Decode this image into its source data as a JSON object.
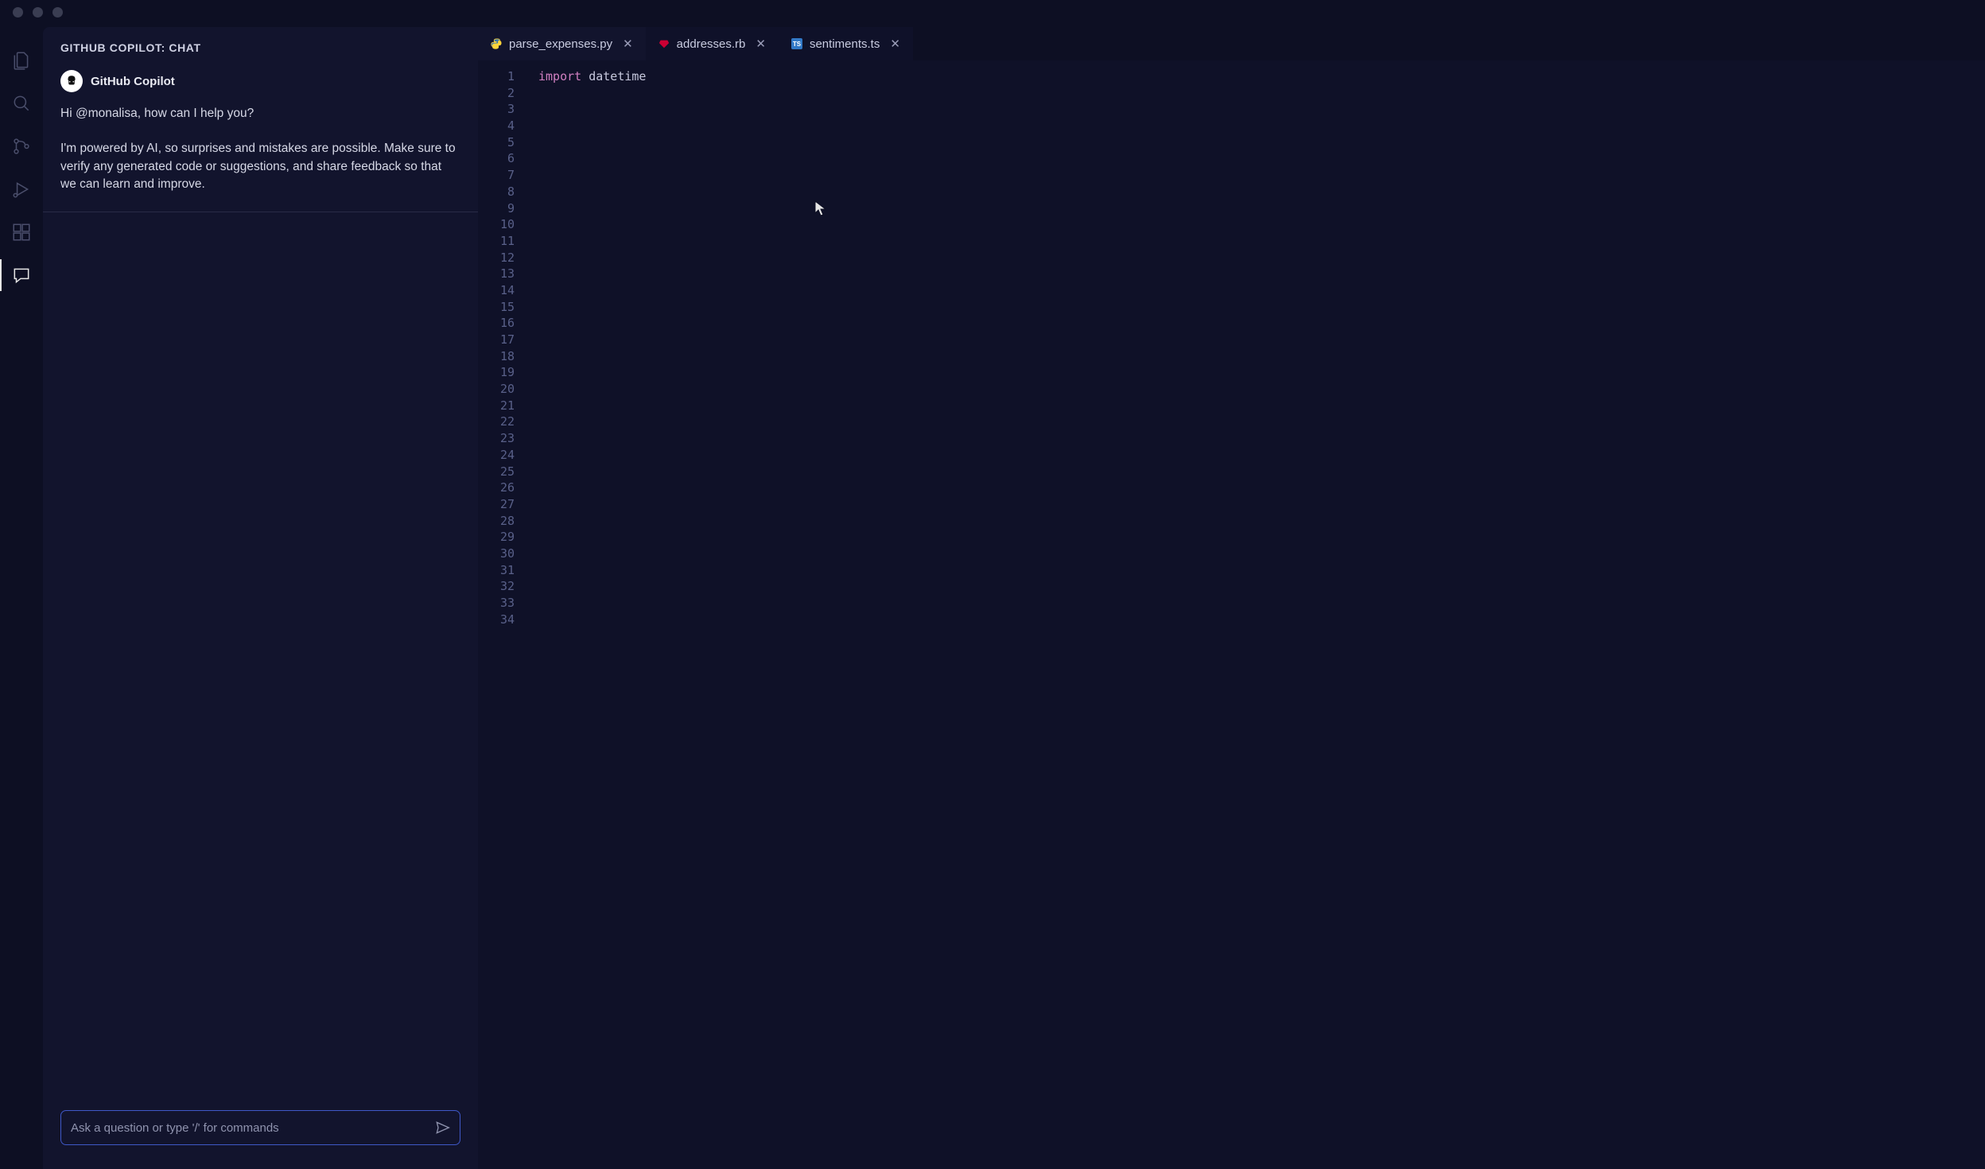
{
  "chat": {
    "header": "GITHUB COPILOT: CHAT",
    "sender_name": "GitHub Copilot",
    "greeting_prefix": "Hi ",
    "greeting_mention": "@monalisa",
    "greeting_suffix": ", how can I help you?",
    "disclaimer": "I'm powered by AI, so surprises and mistakes are possible. Make sure to verify any generated code or suggestions, and share feedback so that we can learn and improve.",
    "input_placeholder": "Ask a question or type '/' for commands"
  },
  "tabs": [
    {
      "label": "parse_expenses.py",
      "lang": "py",
      "active": true
    },
    {
      "label": "addresses.rb",
      "lang": "rb",
      "active": false
    },
    {
      "label": "sentiments.ts",
      "lang": "ts",
      "active": false
    }
  ],
  "editor": {
    "line_count": 34,
    "code_tokens": [
      {
        "text": "import",
        "kind": "kw"
      },
      {
        "text": " datetime",
        "kind": "plain"
      }
    ]
  }
}
